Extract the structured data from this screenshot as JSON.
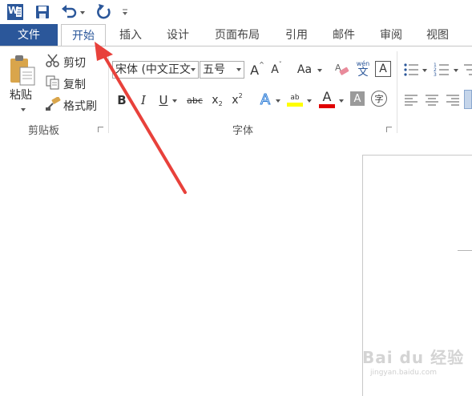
{
  "qat": {
    "icons": [
      "word-logo-icon",
      "save-icon",
      "undo-icon",
      "redo-icon",
      "customize-qat-icon"
    ],
    "word_logo_letter": "W"
  },
  "tabs": [
    {
      "label": "文件"
    },
    {
      "label": "开始"
    },
    {
      "label": "插入"
    },
    {
      "label": "设计"
    },
    {
      "label": "页面布局"
    },
    {
      "label": "引用"
    },
    {
      "label": "邮件"
    },
    {
      "label": "审阅"
    },
    {
      "label": "视图"
    }
  ],
  "active_tab": "开始",
  "clipboard": {
    "paste_label": "粘贴",
    "cut_label": "剪切",
    "copy_label": "复制",
    "format_painter_label": "格式刷",
    "group_label": "剪贴板"
  },
  "font": {
    "font_name": "宋体 (中文正文",
    "font_size": "五号",
    "group_label": "字体",
    "bold": "B",
    "italic": "I",
    "underline": "U",
    "strike": "abc",
    "subscript_base": "x",
    "subscript_mark": "2",
    "superscript_base": "x",
    "superscript_mark": "2",
    "grow": "A",
    "shrink": "A",
    "case": "Aa",
    "phonetic_top": "wén",
    "phonetic_bottom": "文",
    "border_char": "A",
    "text_effect": "A",
    "highlight": "ab",
    "font_color": "A",
    "shading": "A",
    "enclose": "字"
  },
  "colors": {
    "accent": "#2b579a",
    "arrow": "#e8413b",
    "highlight_yellow": "#ffff00",
    "font_color_red": "#e00000"
  },
  "watermark": {
    "text": "Bai du 经验",
    "sub": "jingyan.baidu.com"
  }
}
